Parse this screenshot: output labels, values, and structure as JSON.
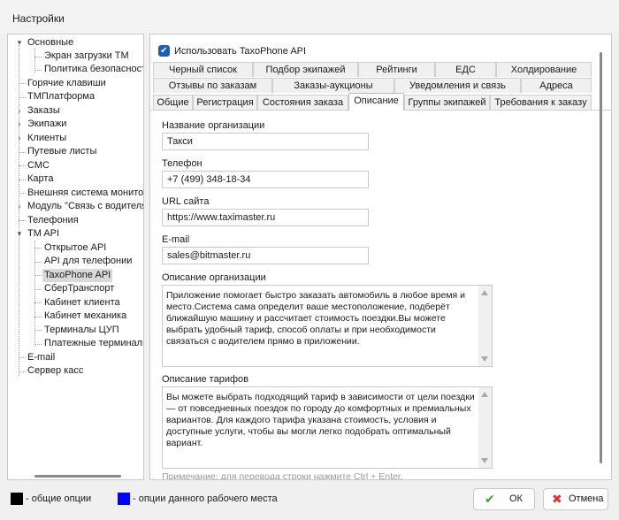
{
  "window": {
    "title": "Настройки"
  },
  "tree": {
    "items": [
      {
        "label": "Основные",
        "glyph": "▾"
      },
      {
        "label": "Экран загрузки ТМ"
      },
      {
        "label": "Политика безопасност"
      },
      {
        "label": "Горячие клавиши"
      },
      {
        "label": "ТМПлатформа"
      },
      {
        "label": "Заказы",
        "glyph": "›"
      },
      {
        "label": "Экипажи",
        "glyph": "›"
      },
      {
        "label": "Клиенты",
        "glyph": "›"
      },
      {
        "label": "Путевые листы"
      },
      {
        "label": "СМС"
      },
      {
        "label": "Карта"
      },
      {
        "label": "Внешняя система монитори"
      },
      {
        "label": "Модуль \"Связь с водителя",
        "glyph": "›"
      },
      {
        "label": "Телефония"
      },
      {
        "label": "TM API",
        "glyph": "▾"
      },
      {
        "label": "Открытое API"
      },
      {
        "label": "API для телефонии"
      },
      {
        "label": "TaxoPhone API"
      },
      {
        "label": "СберТранспорт"
      },
      {
        "label": "Кабинет клиента"
      },
      {
        "label": "Кабинет механика"
      },
      {
        "label": "Терминалы ЦУП"
      },
      {
        "label": "Платежные терминалы"
      },
      {
        "label": "E-mail"
      },
      {
        "label": "Сервер касс"
      }
    ]
  },
  "main": {
    "use_api_label": "Использовать TaxoPhone API",
    "tabs_row1": [
      "Черный список",
      "Подбор экипажей",
      "Рейтинги",
      "ЕДС",
      "Холдирование"
    ],
    "tabs_row2": [
      "Отзывы по заказам",
      "Заказы-аукционы",
      "Уведомления и связь",
      "Адреса"
    ],
    "tabs_row3": [
      "Общие",
      "Регистрация",
      "Состояния заказа",
      "Описание",
      "Группы экипажей",
      "Требования к заказу"
    ],
    "fields": {
      "org_name_label": "Название организации",
      "org_name_value": "Такси",
      "phone_label": "Телефон",
      "phone_value": "+7 (499) 348-18-34",
      "url_label": "URL сайта",
      "url_value": "https://www.taximaster.ru",
      "email_label": "E-mail",
      "email_value": "sales@bitmaster.ru",
      "org_desc_label": "Описание организации",
      "org_desc_value": "Приложение помогает быстро заказать автомобиль в любое время и место.Система сама определит ваше местоположение, подберёт ближайшую машину и рассчитает стоимость поездки.Вы можете выбрать удобный тариф, способ оплаты и при необходимости связаться с водителем прямо в приложении.",
      "tariff_desc_label": "Описание тарифов",
      "tariff_desc_value": "Вы можете выбрать подходящий тариф в зависимости от цели поездки — от повседневных поездок по городу до комфортных и премиальных вариантов. Для каждого тарифа указана стоимость, условия и доступные услуги, чтобы вы могли легко подобрать оптимальный вариант."
    },
    "hint": "Примечание: для перевода строки нажмите Ctrl + Enter."
  },
  "footer": {
    "legend_general": "- общие опции",
    "legend_workplace": "- опции данного рабочего места",
    "legend_general_color": "#000000",
    "legend_workplace_color": "#0000ff",
    "ok_label": "ОК",
    "cancel_label": "Отмена",
    "ok_icon": "check-icon",
    "cancel_icon": "x-icon"
  }
}
